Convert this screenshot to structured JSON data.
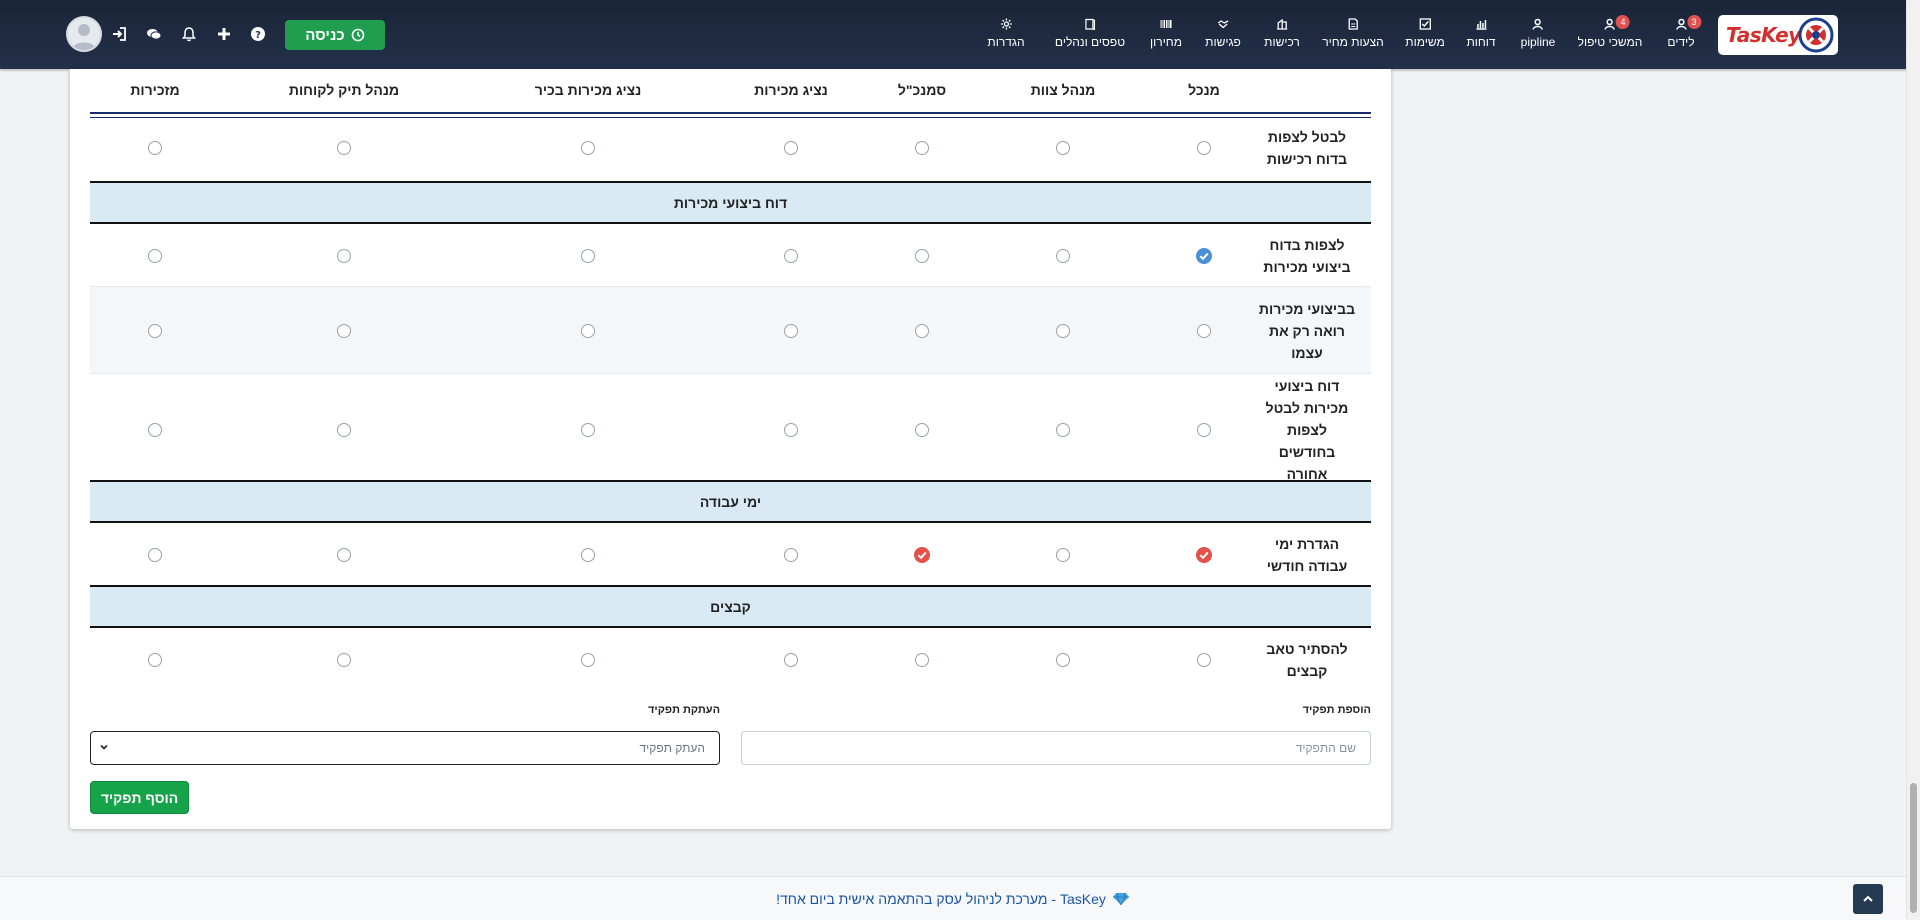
{
  "nav": {
    "logo": "TasKey",
    "items": [
      {
        "label": "לידים",
        "icon": "user-icon",
        "badge": "3"
      },
      {
        "label": "המשכי טיפול",
        "icon": "user-icon",
        "badge": "4"
      },
      {
        "label": "pipline",
        "icon": "user-icon"
      },
      {
        "label": "דוחות",
        "icon": "chart-icon"
      },
      {
        "label": "משימות",
        "icon": "checkbox-icon"
      },
      {
        "label": "הצעות מחיר",
        "icon": "document-icon"
      },
      {
        "label": "רכישות",
        "icon": "building-icon"
      },
      {
        "label": "פגישות",
        "icon": "handshake-icon"
      },
      {
        "label": "מחירון",
        "icon": "barcode-icon"
      },
      {
        "label": "טפסים ונהלים",
        "icon": "book-icon"
      },
      {
        "label": "הגדרות",
        "icon": "gear-icon"
      }
    ],
    "enter_button": "כניסה"
  },
  "table": {
    "headers": [
      "מנכל",
      "מנהל צוות",
      "סמנכ\"ל",
      "נציג מכירות",
      "נציג מכירות בכיר",
      "מנהל תיק לקוחות",
      "מזכירות"
    ],
    "rows": [
      {
        "type": "perm",
        "label": "לבטל לצפות בדוח רכישות",
        "checks": [
          0,
          0,
          0,
          0,
          0,
          0,
          0
        ]
      },
      {
        "type": "section",
        "label": "דוח ביצועי מכירות"
      },
      {
        "type": "perm",
        "label": "לצפות בדוח ביצועי מכירות",
        "checks": [
          "blue",
          0,
          0,
          0,
          0,
          0,
          0
        ]
      },
      {
        "type": "perm",
        "label": "בביצועי מכירות רואה רק את עצמו",
        "checks": [
          0,
          0,
          0,
          0,
          0,
          0,
          0
        ]
      },
      {
        "type": "perm",
        "label": "דוח ביצועי מכירות לבטל לצפות בחודשים אחורה",
        "checks": [
          0,
          0,
          0,
          0,
          0,
          0,
          0
        ]
      },
      {
        "type": "section",
        "label": "ימי עבודה"
      },
      {
        "type": "perm",
        "label": "הגדרת ימי עבודה חודשי",
        "checks": [
          "red",
          0,
          "red",
          0,
          0,
          0,
          0
        ]
      },
      {
        "type": "section",
        "label": "קבצים"
      },
      {
        "type": "perm",
        "label": "להסתיר טאב קבצים",
        "checks": [
          0,
          0,
          0,
          0,
          0,
          0,
          0
        ]
      }
    ]
  },
  "form": {
    "add_role_label": "הוספת תפקיד",
    "add_role_placeholder": "שם התפקיד",
    "copy_role_label": "העתקת תפקיד",
    "copy_role_value": "העתק תפקיד",
    "add_button": "הוסף תפקיד"
  },
  "footer": {
    "text": "TasKey - מערכת לניהול עסק בהתאמה אישית ביום אחד!"
  },
  "colors": {
    "navbar": "#1f2a40",
    "check_blue": "#4a90d9",
    "check_red": "#e4514a",
    "primary_green": "#16a34a",
    "section_bg": "#daeaf5"
  }
}
